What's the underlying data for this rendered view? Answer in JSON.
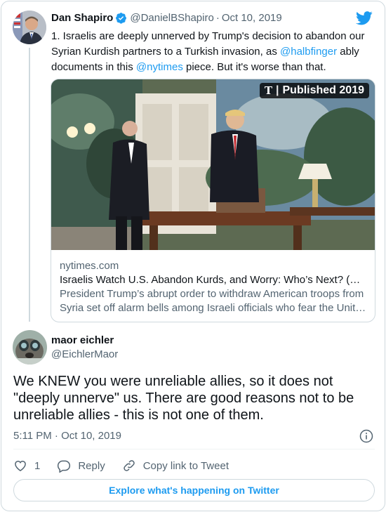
{
  "parent_tweet": {
    "display_name": "Dan Shapiro",
    "handle": "@DanielBShapiro",
    "separator": "·",
    "date": "Oct 10, 2019",
    "text_part1": "1. Israelis are deeply unnerved by Trump's decision to abandon our Syrian Kurdish partners to a Turkish invasion, as ",
    "mention1": "@halbfinger",
    "text_part2": " ably documents in this ",
    "mention2": "@nytimes",
    "text_part3": " piece. But it's worse than that.",
    "avatar_icon": "person-avatar-photo",
    "verified_icon": "verified-badge-icon",
    "brand_icon": "twitter-bird-icon"
  },
  "link_card": {
    "badge_logo": "T",
    "badge_separator": "|",
    "badge_text": "Published 2019",
    "domain": "nytimes.com",
    "title": "Israelis Watch U.S. Abandon Kurds, and Worry: Who’s Next? (…",
    "description_line1": "President Trump’s abrupt order to withdraw American troops from",
    "description_line2": "Syria set off alarm bells among Israeli officials who fear the Unit…"
  },
  "reply_tweet": {
    "display_name": "maor eichler",
    "handle": "@EichlerMaor",
    "text": "We KNEW you were unreliable allies, so it does not \"deeply unnerve\" us. There are good reasons not to be unreliable allies - this is not one of them.",
    "time": "5:11 PM",
    "separator": "·",
    "date": "Oct 10, 2019",
    "avatar_icon": "dog-avatar-photo"
  },
  "actions": {
    "like_count": "1",
    "reply_label": "Reply",
    "copy_link_label": "Copy link to Tweet"
  },
  "explore_button": "Explore what's happening on Twitter",
  "colors": {
    "accent": "#1d9bf0",
    "text_primary": "#0f1419",
    "text_secondary": "#536471",
    "border": "#cfd9de"
  }
}
